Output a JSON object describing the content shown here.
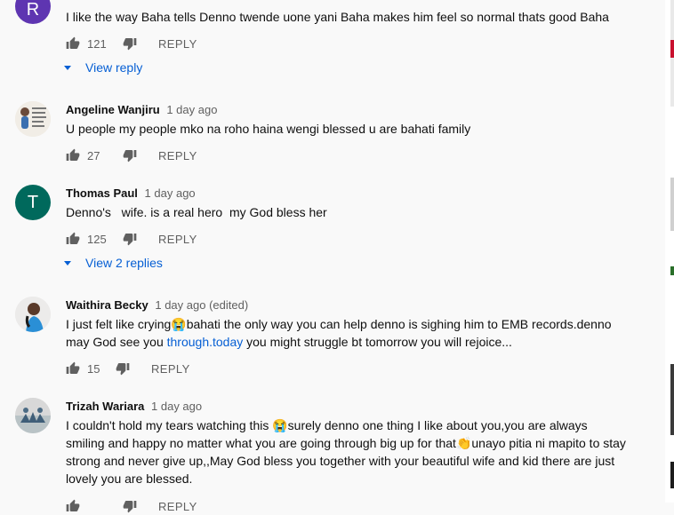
{
  "comments": [
    {
      "author": "",
      "avatar_letter": "R",
      "avatar_color": "#5e35b1",
      "time": "",
      "text": "I like the way Baha tells Denno twende uone yani Baha makes him feel so normal thats good Baha",
      "likes": "121",
      "reply_label": "REPLY",
      "view_replies": "View reply"
    },
    {
      "author": "Angeline Wanjiru",
      "time": "1 day ago",
      "text": "U people my people mko na roho haina wengi blessed u are bahati family",
      "likes": "27",
      "reply_label": "REPLY"
    },
    {
      "author": "Thomas Paul",
      "avatar_letter": "T",
      "avatar_color": "#00695c",
      "time": "1 day ago",
      "text": "Denno's   wife. is a real hero  my God bless her",
      "likes": "125",
      "reply_label": "REPLY",
      "view_replies": "View 2 replies"
    },
    {
      "author": "Waithira Becky",
      "time": "1 day ago (edited)",
      "text_before": "I just felt like crying😭bahati the only way you can help denno is sighing him to EMB records.denno may God see you ",
      "text_link": "through.today",
      "text_after": " you might struggle bt tomorrow you will rejoice...",
      "likes": "15",
      "reply_label": "REPLY"
    },
    {
      "author": "Trizah Wariara",
      "time": "1 day ago",
      "text": "I couldn't hold my tears watching this 😭surely denno one thing I like about you,you are always smiling and happy no matter what you are going through big up for that👏unayo pitia ni mapito to stay strong and never give up,,May God bless you together with your beautiful wife and kid there are just lovely you are blessed.",
      "reply_label": "REPLY"
    }
  ],
  "colors": {
    "link": "#065fd4",
    "meta": "#606060",
    "text": "#0f0f0f"
  }
}
